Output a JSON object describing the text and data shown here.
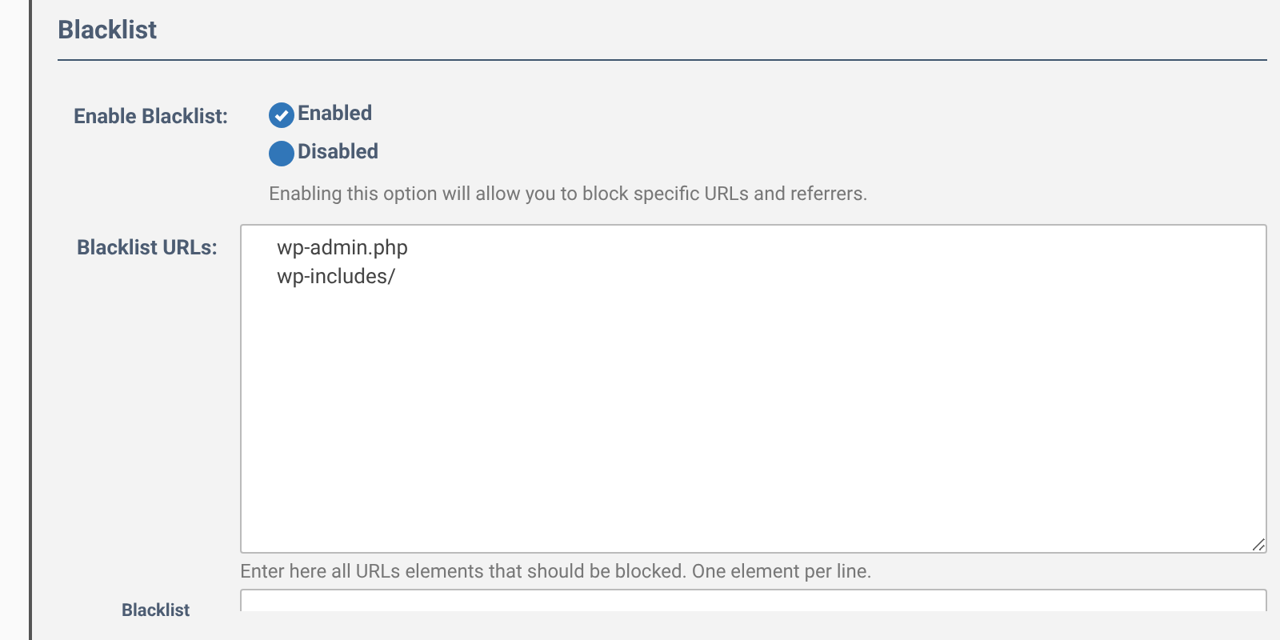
{
  "section": {
    "title": "Blacklist"
  },
  "enable": {
    "label": "Enable Blacklist:",
    "options": [
      {
        "label": "Enabled",
        "selected": true
      },
      {
        "label": "Disabled",
        "selected": false
      }
    ],
    "help": "Enabling this option will allow you to block specific URLs and referrers."
  },
  "urls": {
    "label": "Blacklist URLs:",
    "value": "wp-admin.php\nwp-includes/",
    "help": "Enter here all URLs elements that should be blocked. One element per line."
  },
  "next_field": {
    "label": "Blacklist"
  }
}
